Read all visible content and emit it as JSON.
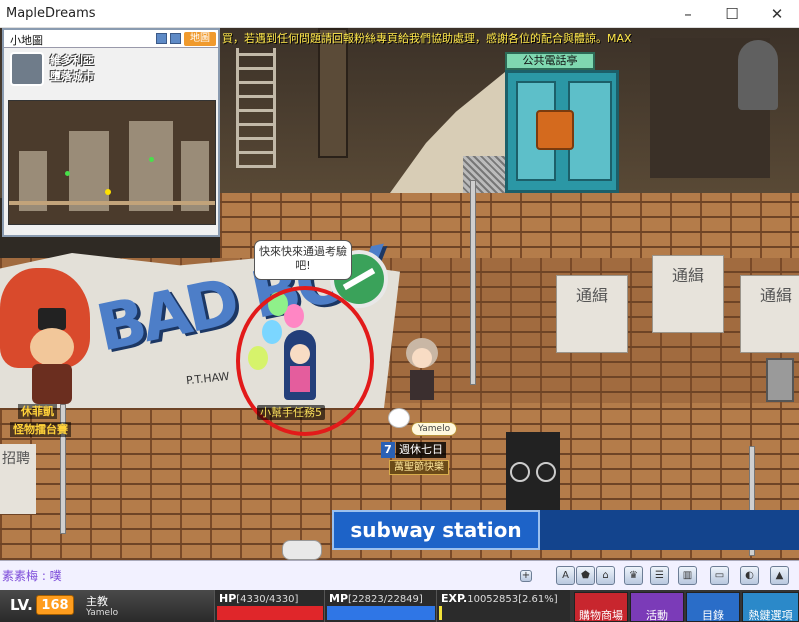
{
  "window": {
    "title": "MapleDreams",
    "minimize": "–",
    "maximize": "☐",
    "close": "✕"
  },
  "ticker": "買，若遇到任何問題請回報粉絲專頁給我們協助處理，感謝各位的配合與體諒。MAX",
  "minimap": {
    "header": "小地圖",
    "map_button": "地圖",
    "region": "維多利亞",
    "city": "墮落城市"
  },
  "scene": {
    "phone_booth_sign": "公共電話亭",
    "graffiti": "BAD BOY",
    "graffiti_sig": "P.T.HAW",
    "posters": [
      "通緝",
      "通緝",
      "通緝"
    ],
    "wall_sign": "招聘",
    "subway_sign": "subway station",
    "speech_bubble": "快來快來通過考驗吧!",
    "npc_tags": [
      "休菲凱",
      "怪物擂台賽"
    ],
    "player_tag": "小幫手任務5",
    "other_player": {
      "name": "Yamelo",
      "guild_level": "7",
      "guild": "週休七日",
      "medal": "萬聖節快樂"
    }
  },
  "chat": {
    "line": "素素梅 : 噗",
    "buttons": [
      "+",
      "A",
      "⬟",
      "⌂",
      "♛",
      "☰",
      "▥",
      "▭",
      "◐",
      "▲"
    ]
  },
  "status": {
    "lv_label": "LV.",
    "level": "168",
    "job": "主教",
    "name": "Yamelo",
    "hp": {
      "label": "HP",
      "value": "[4330/4330]",
      "ratio": 1.0,
      "color": "#e0262a"
    },
    "mp": {
      "label": "MP",
      "value": "[22823/22849]",
      "ratio": 0.999,
      "color": "#2f76e6"
    },
    "exp": {
      "label": "EXP.",
      "value": "10052853[2.61%]",
      "ratio": 0.0261,
      "color": "#f2e23a"
    },
    "menu": [
      {
        "label": "購物商場",
        "color": "#c8262e"
      },
      {
        "label": "活動",
        "color": "#7b3bb8"
      },
      {
        "label": "目錄",
        "color": "#2a6dc8"
      },
      {
        "label": "熱鍵選項",
        "color": "#2b89c9"
      }
    ]
  }
}
